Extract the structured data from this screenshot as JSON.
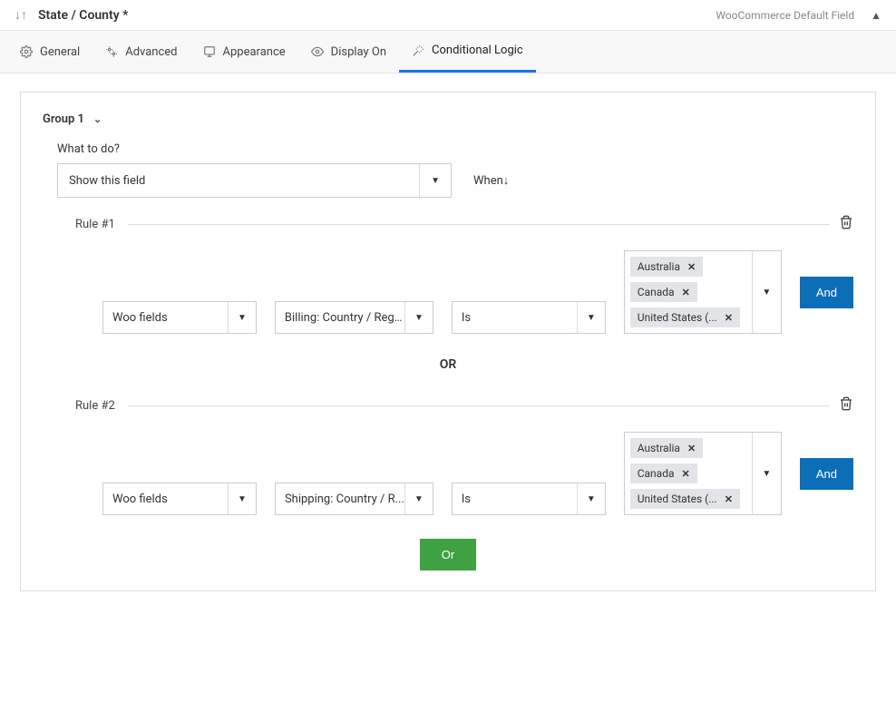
{
  "header": {
    "title": "State / County *",
    "meta": "WooCommerce Default Field"
  },
  "tabs": {
    "general": "General",
    "advanced": "Advanced",
    "appearance": "Appearance",
    "display_on": "Display On",
    "conditional_logic": "Conditional Logic"
  },
  "group": {
    "label": "Group 1",
    "what_label": "What to do?",
    "action": "Show this field",
    "when": "When↓"
  },
  "rules": [
    {
      "title": "Rule #1",
      "source": "Woo fields",
      "field": "Billing: Country / Regi...",
      "operator": "Is",
      "values": [
        "Australia",
        "Canada",
        "United States (..."
      ]
    },
    {
      "title": "Rule #2",
      "source": "Woo fields",
      "field": "Shipping: Country / R...",
      "operator": "Is",
      "values": [
        "Australia",
        "Canada",
        "United States (..."
      ]
    }
  ],
  "buttons": {
    "and": "And",
    "or_divider": "OR",
    "or": "Or"
  }
}
